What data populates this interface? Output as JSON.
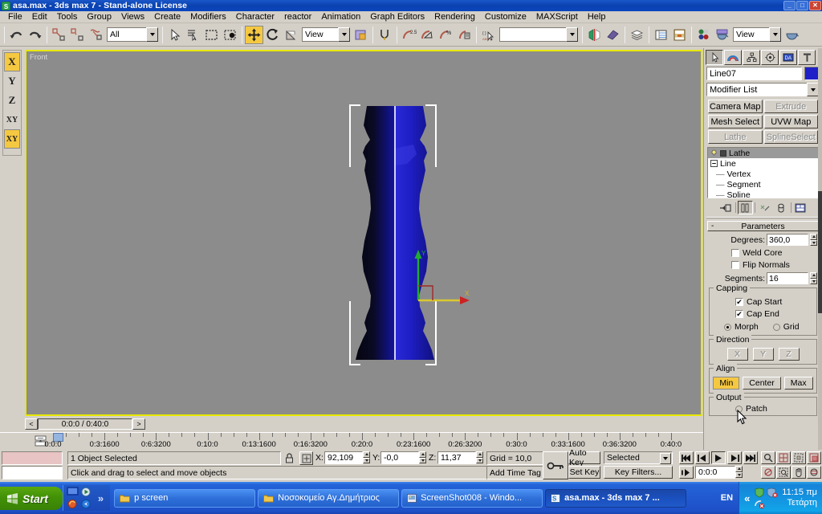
{
  "window": {
    "title": "asa.max - 3ds max 7  - Stand-alone License",
    "icon": "max-logo-icon",
    "minimize": "_",
    "maximize": "□",
    "close": "✕"
  },
  "menu": {
    "items": [
      "File",
      "Edit",
      "Tools",
      "Group",
      "Views",
      "Create",
      "Modifiers",
      "Character",
      "reactor",
      "Animation",
      "Graph Editors",
      "Rendering",
      "Customize",
      "MAXScript",
      "Help"
    ]
  },
  "toolbar": {
    "undo": "undo-icon",
    "redo": "redo-icon",
    "select_link": "select-and-link-icon",
    "unlink": "unlink-selection-icon",
    "bind_spacewarp": "bind-to-space-warp-icon",
    "selection_filter_value": "All",
    "select_object": "select-object-icon",
    "select_by_name": "select-by-name-icon",
    "select_region": "rectangular-selection-region-icon",
    "window_crossing": "window-crossing-icon",
    "select_move": "select-and-move-icon",
    "select_rotate": "select-and-rotate-icon",
    "select_scale": "select-and-uniform-scale-icon",
    "reference_coord_value": "View",
    "use_center": "use-pivot-point-center-icon",
    "mirror": "mirror-icon",
    "align": "align-icon",
    "named_selection_value": "",
    "mirror_tool": "mirror-objects-icon",
    "align_tool": "align-tool-icon",
    "layer_manager": "layer-manager-icon",
    "curve_editor": "curve-editor-icon",
    "schematic_view": "schematic-view-icon",
    "material_editor": "material-editor-icon",
    "render_scene": "render-scene-dialog-icon",
    "render_type_value": "View",
    "quick_render": "quick-render-icon",
    "snap_toggle": "snaps-toggle-icon",
    "angle_snap": "angle-snap-toggle-icon",
    "percent_snap": "percent-snap-toggle-icon",
    "spinner_snap": "spinner-snap-toggle-icon",
    "named_select_sets": "named-selection-sets-icon",
    "angle_snap_label": "2.5"
  },
  "axis_toolbar": {
    "buttons": [
      {
        "label": "X",
        "active": true
      },
      {
        "label": "Y",
        "active": false
      },
      {
        "label": "Z",
        "active": false
      },
      {
        "label": "XY",
        "active": false
      },
      {
        "label": "XY",
        "active": true
      }
    ]
  },
  "viewport": {
    "label": "Front",
    "background": "#8c8c8c",
    "active_border": "#e8e800",
    "object_color": "#2020c8",
    "gizmo": {
      "x_axis_color": "#cc2222",
      "y_axis_color": "#22aa33",
      "x_label": "X",
      "y_label": "Y"
    }
  },
  "time_slider": {
    "current": "0:0:0 / 0:40:0",
    "prev": "<",
    "next": ">"
  },
  "track_bar": {
    "labels": [
      "0:0:0",
      "0:3:1600",
      "0:6:3200",
      "0:10:0",
      "0:13:1600",
      "0:16:3200",
      "0:20:0",
      "0:23:1600",
      "0:26:3200",
      "0:30:0",
      "0:33:1600",
      "0:36:3200",
      "0:40:0"
    ]
  },
  "status_bar": {
    "selection": "1 Object Selected",
    "prompt": "Click and drag to select and move objects",
    "lock_icon": "lock-selection-icon",
    "abs_rel_icon": "absolute-relative-transform-icon",
    "x_label": "X:",
    "x_value": "92,109",
    "y_label": "Y:",
    "y_value": "-0,0",
    "z_label": "Z:",
    "z_value": "11,37",
    "grid": "Grid = 10,0",
    "add_time_tag": "Add Time Tag",
    "key_mode_icon": "key-mode-toggle-icon"
  },
  "animation": {
    "auto_key": "Auto Key",
    "set_key": "Set Key",
    "key_filters": "Key Filters...",
    "selection_level_value": "Selected",
    "frame_value": "0:0:0",
    "go_to_start": "go-to-start-icon",
    "previous_frame": "previous-frame-icon",
    "play": "play-animation-icon",
    "next_frame": "next-frame-icon",
    "go_to_end": "go-to-end-icon",
    "key_mode": "key-mode-toggle-icon"
  },
  "viewport_nav": {
    "zoom": "zoom-icon",
    "zoom_all": "zoom-all-icon",
    "zoom_extents": "zoom-extents-icon",
    "zoom_extents_all": "zoom-extents-all-icon",
    "field_of_view": "field-of-view-icon",
    "region_zoom": "region-zoom-icon",
    "pan": "pan-view-icon",
    "arc_rotate": "arc-rotate-icon",
    "maximize_viewport": "maximize-viewport-toggle-icon"
  },
  "command_panel": {
    "tabs": [
      {
        "name": "create-tab",
        "icon": "arrow-cursor-icon",
        "active": true
      },
      {
        "name": "modify-tab",
        "icon": "rainbow-arc-icon",
        "active": false
      },
      {
        "name": "hierarchy-tab",
        "icon": "hierarchy-tree-icon",
        "active": false
      },
      {
        "name": "motion-tab",
        "icon": "motion-wheel-icon",
        "active": false
      },
      {
        "name": "display-tab",
        "icon": "display-monitor-icon",
        "active": false
      },
      {
        "name": "utilities-tab",
        "icon": "hammer-icon",
        "active": false
      }
    ],
    "object_name": "Line07",
    "object_color": "#2020c8",
    "modifier_list": "Modifier List",
    "modifier_buttons": [
      {
        "label": "Camera Map",
        "disabled": false
      },
      {
        "label": "Extrude",
        "disabled": true
      },
      {
        "label": "Mesh Select",
        "disabled": false
      },
      {
        "label": "UVW Map",
        "disabled": false
      },
      {
        "label": "Lathe",
        "disabled": true
      },
      {
        "label": "SplineSelect",
        "disabled": true
      }
    ],
    "stack": [
      {
        "label": "Lathe",
        "selected": true,
        "indent": 0,
        "bulb": true,
        "box": true
      },
      {
        "label": "Line",
        "selected": false,
        "indent": 0,
        "expander": "minus"
      },
      {
        "label": "Vertex",
        "selected": false,
        "indent": 1
      },
      {
        "label": "Segment",
        "selected": false,
        "indent": 1
      },
      {
        "label": "Spline",
        "selected": false,
        "indent": 1
      }
    ],
    "stack_tools": [
      {
        "name": "pin-stack-icon"
      },
      {
        "name": "show-end-result-icon",
        "pressed": true
      },
      {
        "name": "make-unique-icon"
      },
      {
        "name": "remove-modifier-icon"
      },
      {
        "name": "configure-modifier-sets-icon"
      }
    ],
    "parameters": {
      "title": "Parameters",
      "minimize": "-",
      "degrees_label": "Degrees:",
      "degrees_value": "360,0",
      "weld_core_label": "Weld Core",
      "weld_core_checked": false,
      "flip_normals_label": "Flip Normals",
      "flip_normals_checked": false,
      "segments_label": "Segments:",
      "segments_value": "16",
      "capping_label": "Capping",
      "cap_start_label": "Cap Start",
      "cap_start_checked": true,
      "cap_end_label": "Cap End",
      "cap_end_checked": true,
      "morph_label": "Morph",
      "morph_selected": true,
      "grid_label": "Grid",
      "grid_selected": false,
      "direction_label": "Direction",
      "direction_buttons": [
        "X",
        "Y",
        "Z"
      ],
      "align_label": "Align",
      "align_buttons": [
        {
          "label": "Min",
          "hot": true
        },
        {
          "label": "Center",
          "hot": false
        },
        {
          "label": "Max",
          "hot": false
        }
      ],
      "output_label": "Output",
      "patch_label": "Patch",
      "patch_selected": false
    }
  },
  "taskbar": {
    "start": "Start",
    "start_icon": "windows-flag-icon",
    "quick_launch": [
      "show-desktop-icon",
      "media-player-icon",
      "firefox-icon",
      "internet-explorer-icon"
    ],
    "overflow": "»",
    "items": [
      {
        "label": "p screen",
        "icon": "folder-icon",
        "active": false
      },
      {
        "label": "Νοσοκομείο Αγ.Δημήτριος",
        "icon": "folder-icon",
        "active": false
      },
      {
        "label": "ScreenShot008 - Windo...",
        "icon": "image-viewer-icon",
        "active": false
      },
      {
        "label": "asa.max - 3ds max 7  ...",
        "icon": "max-logo-icon",
        "active": true
      }
    ],
    "language": "EN",
    "tray_expand": "«",
    "tray_icons": [
      "security-shield-icon",
      "antivirus-alert-icon",
      "network-disabled-icon"
    ],
    "time": "11:15 πμ",
    "day": "Τετάρτη"
  }
}
